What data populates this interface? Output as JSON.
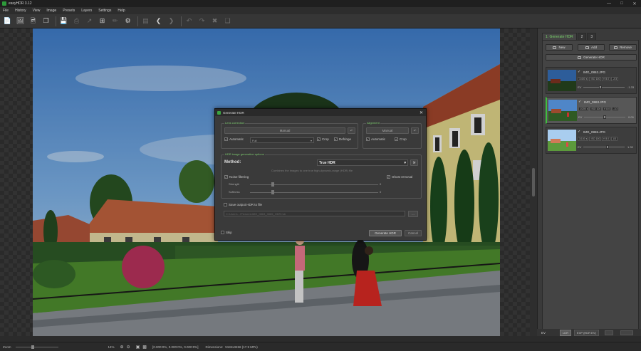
{
  "window": {
    "title": "easyHDR 3.12"
  },
  "menu": [
    "File",
    "History",
    "View",
    "Image",
    "Presets",
    "Layers",
    "Settings",
    "Help"
  ],
  "canvas": {
    "background": "#262626"
  },
  "panel": {
    "tabs": [
      "1: Generate HDR",
      "2",
      "3"
    ],
    "buttons": {
      "new": "New",
      "add": "Add",
      "remove": "Remove",
      "generate": "Generate HDR"
    },
    "images": [
      {
        "name": "IMG_0863.JPG",
        "exif": [
          "1/400 s",
          "ISO 100",
          "f/ 8.0",
          "-2/3"
        ],
        "ev_label": "EV",
        "ev": "-1.33",
        "level": 0.42
      },
      {
        "name": "IMG_0863.JPG",
        "exif": [
          "1/200 s",
          "ISO 100",
          "f/ 8.0",
          "-1/3"
        ],
        "ev_label": "EV",
        "ev": "0.00",
        "level": 0.5
      },
      {
        "name": "IMG_0865.JPG",
        "exif": [
          "1/100 s",
          "ISO 100",
          "f/ 8.0",
          "1/3"
        ],
        "ev_label": "EV",
        "ev": "1.33",
        "level": 0.58
      }
    ],
    "bottom": {
      "ev_label": "EV",
      "ldr": "LDR",
      "exp": "EXP (HDR EV)"
    }
  },
  "dialog": {
    "title": "Generate HDR",
    "lens": {
      "label": "Lens correction",
      "manual": "Manual",
      "automatic": "Automatic",
      "profile": "Full",
      "crop": "Crop",
      "defringe": "Defringe"
    },
    "align": {
      "label": "Alignment",
      "manual": "Manual",
      "automatic": "Automatic",
      "crop": "Crop"
    },
    "options": {
      "label": "HDR image generation options",
      "method_label": "Method:",
      "method_value": "True HDR",
      "hint": "Combines the images to one true high-dynamic-range (HDR) file",
      "noise": "Noise filtering",
      "strength": "Strength",
      "strength_val": "0",
      "softness": "Softness",
      "softness_val": "0",
      "ghost": "Ghost removal"
    },
    "save": "Save output HDR to file",
    "path": "C:\\Users\\...\\Pictures\\IMG_0863_0865_HDR.hdr",
    "skip": "Skip",
    "generate": "Generate HDR",
    "cancel": "Cancel"
  },
  "status": {
    "zoom_label": "Zoom",
    "zoom_value": "14%",
    "coords": "[0.000:0%, 0.000:0%, 0.000:0%]",
    "dimensions_label": "Dimensions:",
    "dimensions": "5184x3456 (17.9 MPx)"
  }
}
